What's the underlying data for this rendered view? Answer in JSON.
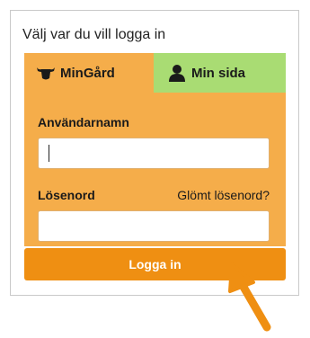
{
  "panel": {
    "title": "Välj var du vill logga in"
  },
  "tabs": [
    {
      "label": "MinGård",
      "icon": "cow-head-icon",
      "color": "#f5ad4a",
      "selected": true
    },
    {
      "label": "Min sida",
      "icon": "person-icon",
      "color": "#a9dc73",
      "selected": false
    }
  ],
  "form": {
    "username_label": "Användarnamn",
    "username_value": "",
    "password_label": "Lösenord",
    "password_value": "",
    "forgot_link": "Glömt lösenord?",
    "submit_label": "Logga in"
  },
  "colors": {
    "form_background": "#f5ad4a",
    "button": "#ef8f12",
    "arrow": "#ef8f12"
  }
}
